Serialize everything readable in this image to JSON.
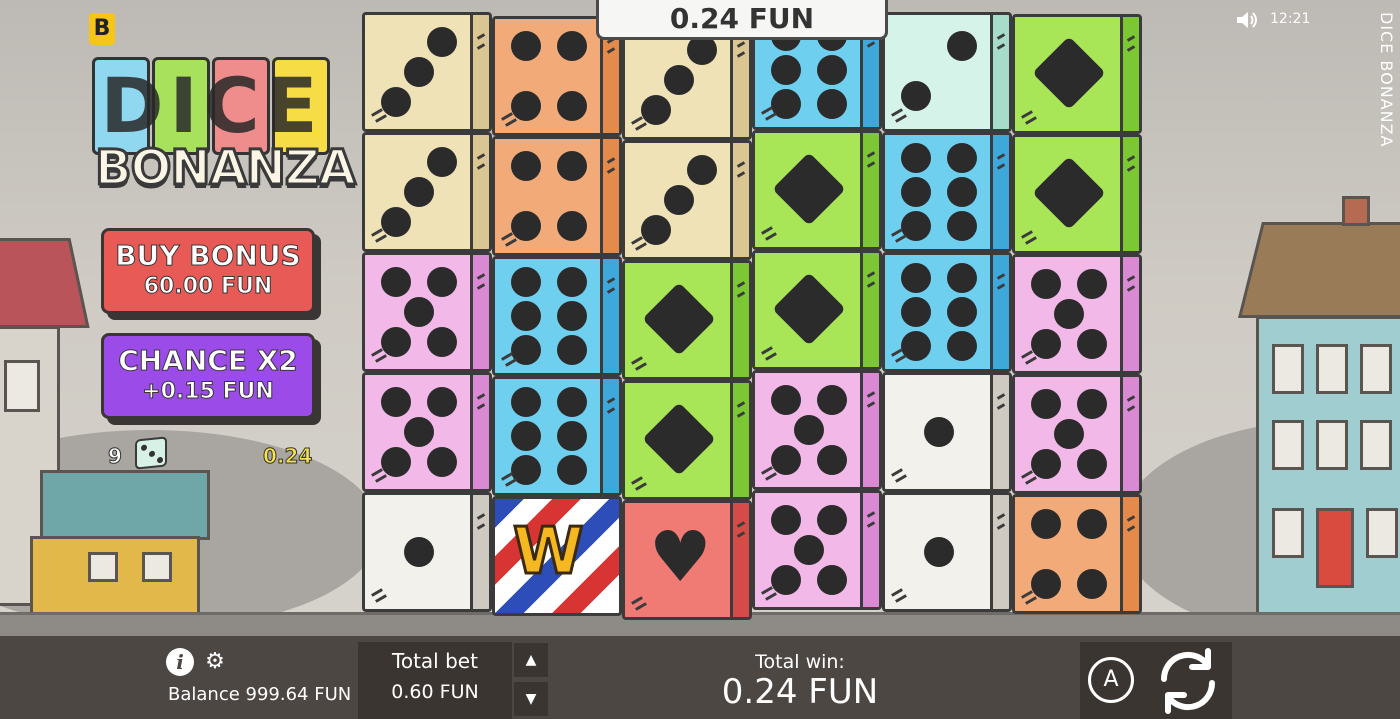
{
  "logo": {
    "badge": "B",
    "title_top": "DICE",
    "title_bottom": "BONANZA"
  },
  "side_buttons": {
    "buy_bonus": {
      "label": "BUY BONUS",
      "price": "60.00 FUN"
    },
    "chance": {
      "label": "CHANCE X2",
      "price": "+0.15 FUN"
    }
  },
  "scatter": {
    "count": "9",
    "value": "0.24"
  },
  "top_win": "0.24 FUN",
  "status": {
    "time": "12:21",
    "vertical_title": "DICE BONANZA"
  },
  "bottom": {
    "balance": "Balance 999.64 FUN",
    "total_bet_label": "Total bet",
    "total_bet_value": "0.60 FUN",
    "total_win_label": "Total win:",
    "total_win_value": "0.24 FUN",
    "auto_label": "A",
    "gear_glyph": "⚙",
    "info_glyph": "i",
    "up_glyph": "▲",
    "down_glyph": "▼"
  },
  "colors": {
    "cream": [
      "#efe2b7",
      "#d9c693"
    ],
    "orange": [
      "#f2ab78",
      "#e48b4b"
    ],
    "blue": [
      "#6fcfee",
      "#3fa8da"
    ],
    "mint": [
      "#d6f3ea",
      "#a7dccb"
    ],
    "green": [
      "#a8e658",
      "#7cc834"
    ],
    "pink": [
      "#f2b8e8",
      "#d98ad3"
    ],
    "white": [
      "#f3f1ec",
      "#cfcac1"
    ],
    "red": [
      "#ef7b74",
      "#d44b47"
    ]
  },
  "grid": [
    [
      {
        "c": "cream",
        "s": "3"
      },
      {
        "c": "cream",
        "s": "3"
      },
      {
        "c": "pink",
        "s": "5"
      },
      {
        "c": "pink",
        "s": "5"
      },
      {
        "c": "white",
        "s": "1"
      }
    ],
    [
      {
        "c": "orange",
        "s": "4"
      },
      {
        "c": "orange",
        "s": "4"
      },
      {
        "c": "blue",
        "s": "6"
      },
      {
        "c": "blue",
        "s": "6"
      },
      {
        "c": "wild",
        "s": "W"
      }
    ],
    [
      {
        "c": "cream",
        "s": "3"
      },
      {
        "c": "cream",
        "s": "3"
      },
      {
        "c": "green",
        "s": "D"
      },
      {
        "c": "green",
        "s": "D"
      },
      {
        "c": "red",
        "s": "H"
      }
    ],
    [
      {
        "c": "blue",
        "s": "6"
      },
      {
        "c": "green",
        "s": "D"
      },
      {
        "c": "green",
        "s": "D"
      },
      {
        "c": "pink",
        "s": "5"
      },
      {
        "c": "pink",
        "s": "5"
      }
    ],
    [
      {
        "c": "mint",
        "s": "2"
      },
      {
        "c": "blue",
        "s": "6"
      },
      {
        "c": "blue",
        "s": "6"
      },
      {
        "c": "white",
        "s": "1"
      },
      {
        "c": "white",
        "s": "1"
      }
    ],
    [
      {
        "c": "green",
        "s": "D"
      },
      {
        "c": "green",
        "s": "D"
      },
      {
        "c": "pink",
        "s": "5"
      },
      {
        "c": "pink",
        "s": "5"
      },
      {
        "c": "orange",
        "s": "4"
      }
    ]
  ]
}
